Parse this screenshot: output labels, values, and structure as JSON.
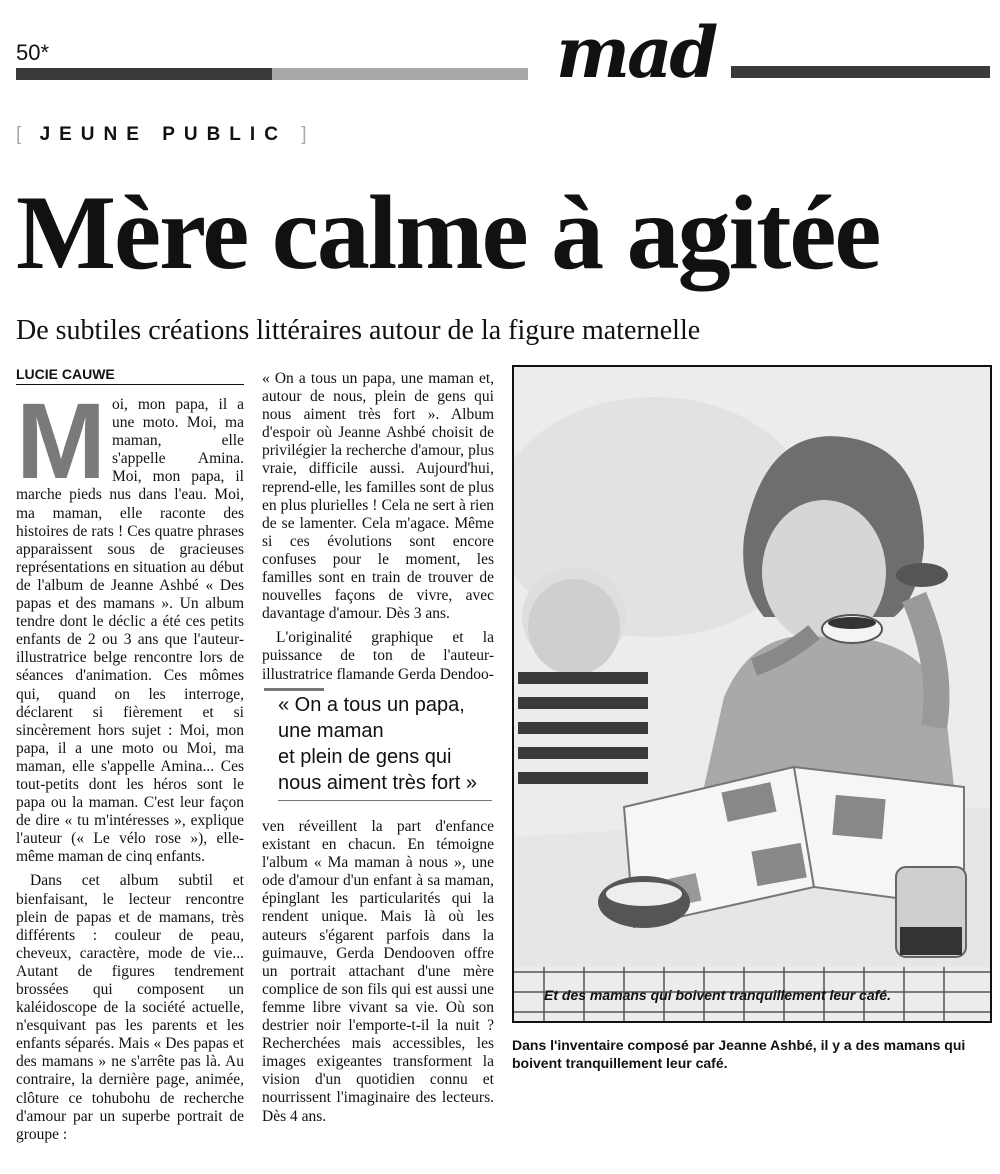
{
  "header": {
    "page_number": "50*",
    "section_logo": "mad"
  },
  "rubric": {
    "open": "[",
    "label": "JEUNE PUBLIC",
    "close": "]"
  },
  "article": {
    "headline": "Mère calme à agitée",
    "subtitle": "De subtiles créations littéraires autour de la figure maternelle",
    "author": "LUCIE CAUWE",
    "drop_cap": "M",
    "col1_p1": "oi, mon papa, il a une moto. Moi, ma maman, elle s'appelle Amina. Moi, mon papa, il marche pieds nus dans l'eau. Moi, ma maman, elle raconte des histoires de rats ! Ces quatre phrases apparaissent sous de gracieuses représentations en situation au début de l'album de Jeanne Ashbé « Des papas et des mamans ». Un album tendre dont le déclic a été ces petits enfants de 2 ou 3 ans que l'auteur-illustratrice belge rencontre lors de séances d'animation. Ces mômes qui, quand on les interroge, déclarent si fièrement et si sincèrement hors sujet : Moi, mon papa, il a une moto ou Moi, ma maman, elle s'appelle Amina... Ces tout-petits dont les héros sont le papa ou la maman. C'est leur façon de dire « tu m'intéresses », explique l'auteur (« Le vélo rose »), elle-même maman de cinq enfants.",
    "col1_p2": "Dans cet album subtil et bienfaisant, le lecteur rencontre plein de papas et de mamans, très différents : couleur de peau, cheveux, caractère, mode de vie... Autant de figures tendrement brossées qui composent un kaléidoscope de la société actuelle, n'esquivant pas les parents et les enfants séparés. Mais « Des papas et des mamans » ne s'arrête pas là. Au contraire, la dernière page, animée, clôture ce tohubohu de recherche d'amour par un superbe portrait de groupe :",
    "col2_p1": "« On a tous un papa, une maman et, autour de nous, plein de gens qui nous aiment très fort ». Album d'espoir où Jeanne Ashbé choisit de privilégier la recherche d'amour, plus vraie, difficile aussi. Aujourd'hui, reprend-elle, les familles sont de plus en plus plurielles ! Cela ne sert à rien de se lamenter. Cela m'agace. Même si ces évolutions sont encore confuses pour le moment, les familles sont en train de trouver de nouvelles façons de vivre, avec davantage d'amour. Dès 3 ans.",
    "col2_p2": "L'originalité graphique et la puissance de ton de l'auteur-illustratrice flamande Gerda Dendoo-",
    "col2_p3": "ven réveillent la part d'enfance existant en chacun. En témoigne l'album « Ma maman à nous », une ode d'amour d'un enfant à sa maman, épinglant les particularités qui la rendent unique. Mais là où les auteurs s'égarent parfois dans la guimauve, Gerda Dendooven offre un portrait attachant d'une mère complice de son fils qui est aussi une femme libre vivant sa vie. Où son destrier noir l'emporte-t-il la nuit ? Recherchées mais accessibles, les images exigeantes transforment la vision d'un quotidien connu et nourrissent l'imaginaire des lecteurs. Dès 4 ans."
  },
  "pullquote": {
    "line1": "« On a tous un papa,",
    "line2": "une maman",
    "line3": "et plein de gens qui",
    "line4": "nous aiment très fort »"
  },
  "illustration": {
    "inset_caption": "Et des mamans qui boivent tranquillement leur café.",
    "caption": "Dans l'inventaire composé par Jeanne Ashbé, il y a des mamans qui boivent tranquillement leur café."
  }
}
